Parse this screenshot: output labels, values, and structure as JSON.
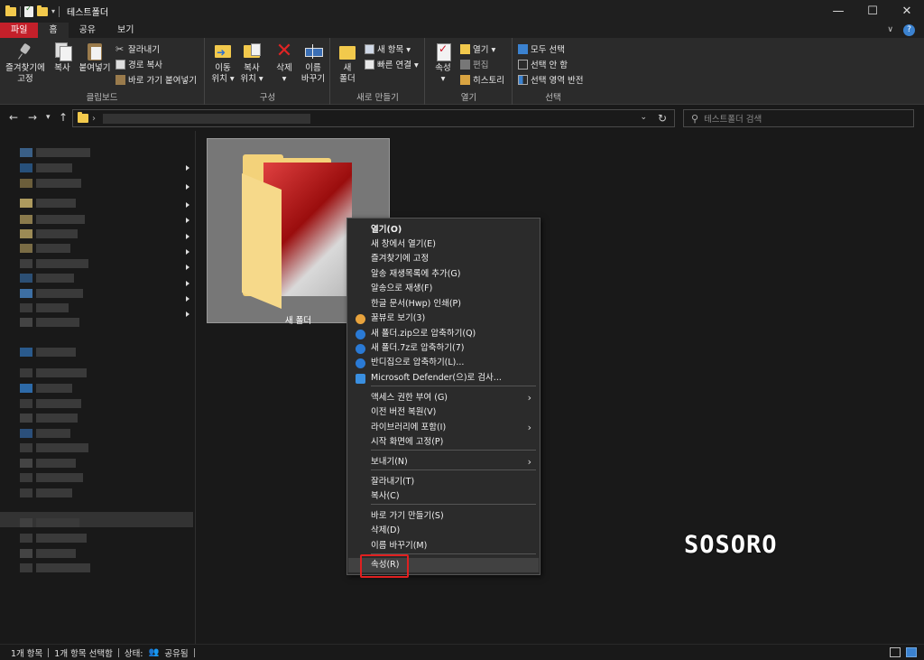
{
  "window": {
    "title": "테스트폴더",
    "minimize": "—",
    "maximize": "☐",
    "close": "✕"
  },
  "ribbon_tabs": [
    "파일",
    "홈",
    "공유",
    "보기"
  ],
  "ribbon": {
    "clipboard": {
      "label": "클립보드",
      "pin": "즐겨찾기에\n고정",
      "copy": "복사",
      "paste": "붙여넣기",
      "cut": "잘라내기",
      "copy_path": "경로 복사",
      "paste_shortcut": "바로 가기 붙여넣기"
    },
    "organize": {
      "label": "구성",
      "move_to": "이동\n위치 ▾",
      "copy_to": "복사\n위치 ▾",
      "delete": "삭제\n▾",
      "rename": "이름\n바꾸기"
    },
    "new": {
      "label": "새로 만들기",
      "new_folder": "새\n폴더",
      "new_item": "새 항목 ▾",
      "easy_access": "빠른 연결 ▾"
    },
    "open": {
      "label": "열기",
      "properties": "속성\n▾",
      "open": "열기 ▾",
      "edit": "편집",
      "history": "히스토리"
    },
    "select": {
      "label": "선택",
      "select_all": "모두 선택",
      "select_none": "선택 안 함",
      "invert": "선택 영역 반전"
    }
  },
  "nav": {
    "back": "←",
    "forward": "→",
    "recent": "▾",
    "up": "↑",
    "search_placeholder": "테스트폴더 검색"
  },
  "content": {
    "folder_name": "새 폴더"
  },
  "context_menu": [
    {
      "label": "열기(O)",
      "bold": true
    },
    {
      "label": "새 창에서 열기(E)"
    },
    {
      "label": "즐겨찾기에 고정"
    },
    {
      "label": "알송 재생목록에 추가(G)"
    },
    {
      "label": "알송으로 재생(F)"
    },
    {
      "label": "한글 문서(Hwp) 인쇄(P)"
    },
    {
      "label": "꿀뷰로 보기(3)",
      "icon": "honeyview-icon"
    },
    {
      "label": "새 폴더.zip으로 압축하기(Q)",
      "icon": "bandizip-icon"
    },
    {
      "label": "새 폴더.7z로 압축하기(7)",
      "icon": "bandizip-icon"
    },
    {
      "label": "반디집으로 압축하기(L)...",
      "icon": "bandizip-icon"
    },
    {
      "label": "Microsoft Defender(으)로 검사...",
      "icon": "defender-icon"
    },
    {
      "label": "액세스 권한 부여 (G)",
      "submenu": true
    },
    {
      "label": "이전 버전 복원(V)"
    },
    {
      "label": "라이브러리에 포함(I)",
      "submenu": true
    },
    {
      "label": "시작 화면에 고정(P)"
    },
    {
      "label": "보내기(N)",
      "submenu": true
    },
    {
      "label": "잘라내기(T)"
    },
    {
      "label": "복사(C)"
    },
    {
      "label": "바로 가기 만들기(S)"
    },
    {
      "label": "삭제(D)"
    },
    {
      "label": "이름 바꾸기(M)"
    },
    {
      "label": "속성(R)",
      "hover": true
    }
  ],
  "watermark": "SOSORO",
  "status": {
    "count": "1개 항목",
    "selected": "1개 항목 선택함",
    "state_label": "상태:",
    "state_value": "공유됨"
  },
  "colors": {
    "file_tab": "#c4202a",
    "highlight": "#e02020",
    "folder": "#f2c94c"
  }
}
